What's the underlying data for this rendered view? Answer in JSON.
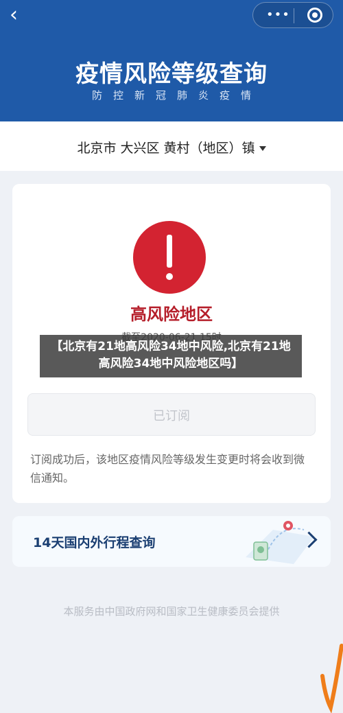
{
  "header": {
    "title": "疫情风险等级查询",
    "subtitle": "防控新冠肺炎疫情",
    "back_icon": "back-chevron-icon",
    "menu_icon": "more-dots-icon",
    "close_icon": "target-close-icon",
    "color": "#1f5aa8"
  },
  "location": {
    "text": "北京市 大兴区 黄村（地区）镇"
  },
  "status": {
    "risk_level": "高风险地区",
    "date_text": "截至2020-06-21 15时",
    "color": "#d32331"
  },
  "subscribe": {
    "label": "已订阅",
    "note": "订阅成功后，该地区疫情风险等级发生变更时将会收到微信通知。"
  },
  "trip": {
    "label": "14天国内外行程查询"
  },
  "footer": {
    "text": "本服务由中国政府网和国家卫生健康委员会提供"
  },
  "overlay": {
    "text": "【北京有21地高风险34地中风险,北京有21地高风险34地中风险地区吗】"
  }
}
